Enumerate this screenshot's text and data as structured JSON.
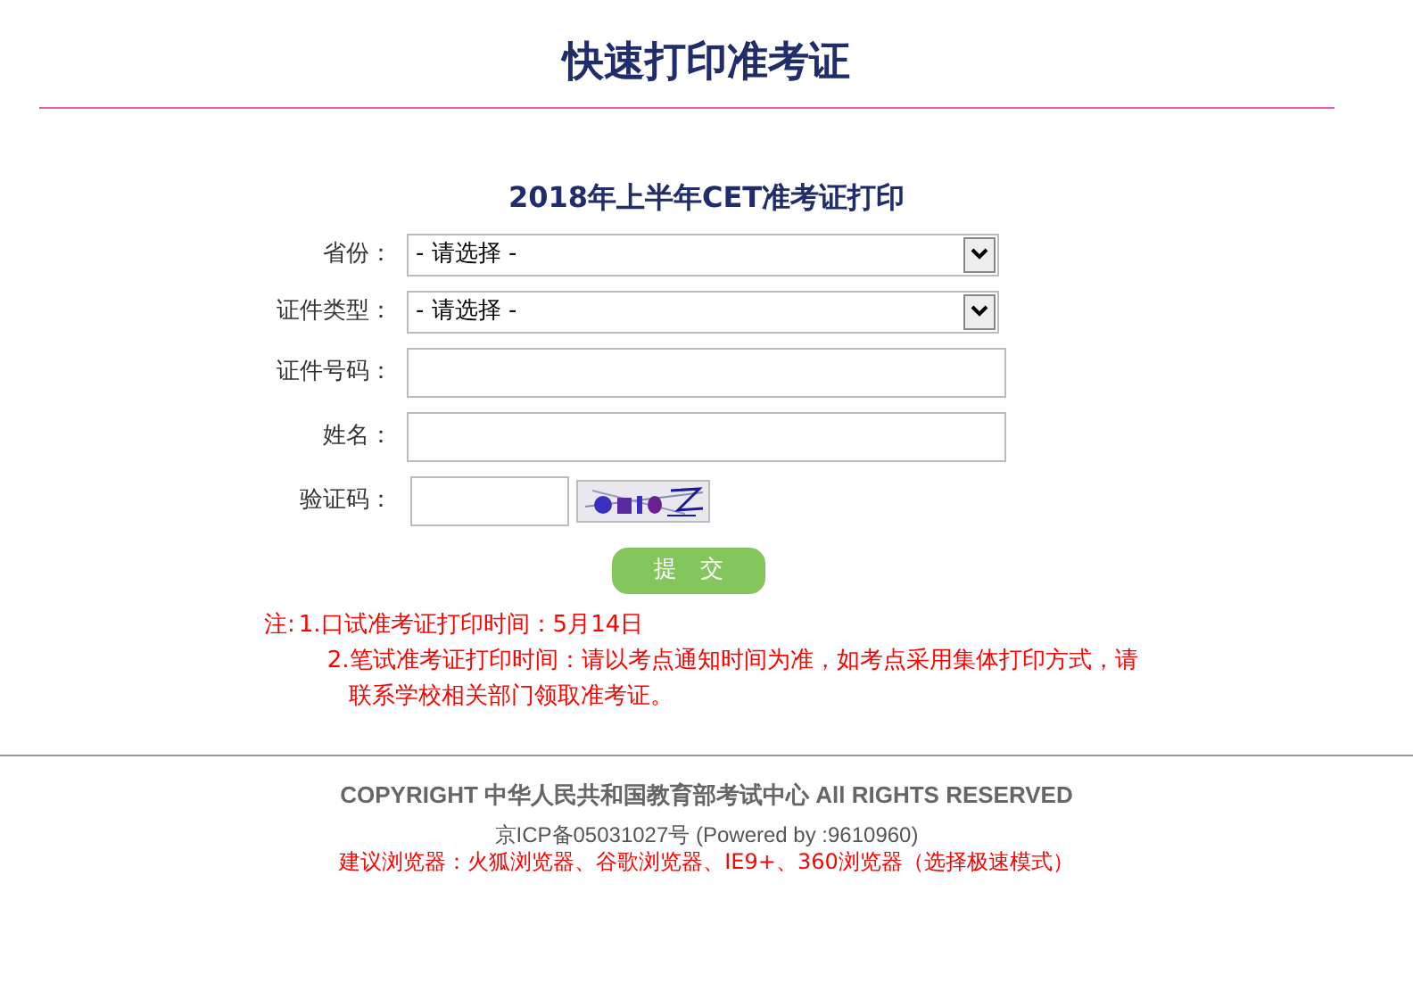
{
  "page_title": "快速打印准考证",
  "form": {
    "title": "2018年上半年CET准考证打印",
    "fields": [
      {
        "kind": "select",
        "label": "省份：",
        "value": "- 请选择 -"
      },
      {
        "kind": "select",
        "label": "证件类型：",
        "value": "- 请选择 -"
      },
      {
        "kind": "text",
        "label": "证件号码："
      },
      {
        "kind": "text",
        "label": "姓名："
      },
      {
        "kind": "captcha",
        "label": "验证码："
      }
    ],
    "submit": "提　交"
  },
  "notes": {
    "label": "注:",
    "items": [
      "1.口试准考证打印时间：5月14日",
      "2.笔试准考证打印时间：请以考点通知时间为准，如考点采用集体打印方式，请联系学校相关部门领取准考证。"
    ]
  },
  "footer": {
    "copyright": "COPYRIGHT 中华人民共和国教育部考试中心 All RIGHTS RESERVED",
    "icp": "京ICP备05031027号 (Powered by :9610960)",
    "browsers": "建议浏览器：火狐浏览器、谷歌浏览器、IE9+、360浏览器（选择极速模式）"
  }
}
